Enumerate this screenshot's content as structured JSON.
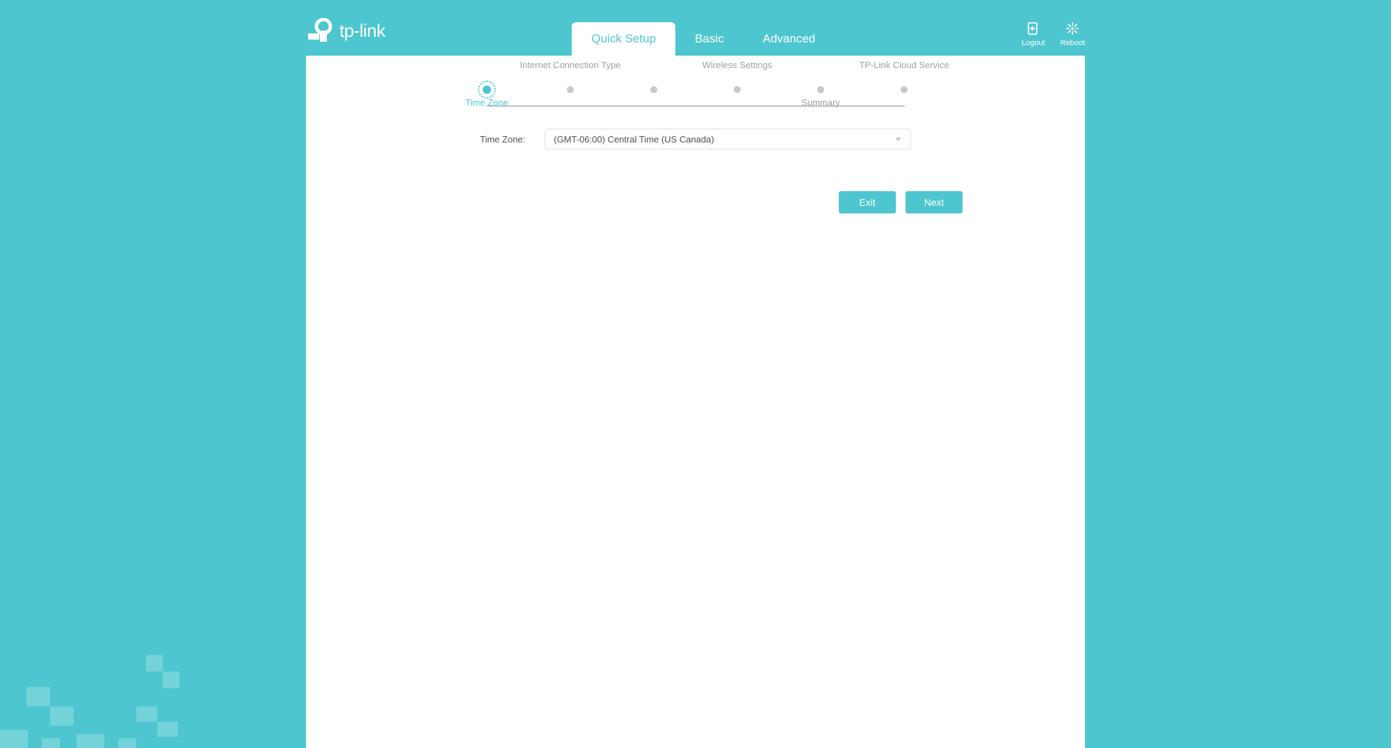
{
  "brand": "tp-link",
  "nav": {
    "tabs": [
      {
        "label": "Quick Setup",
        "active": true
      },
      {
        "label": "Basic",
        "active": false
      },
      {
        "label": "Advanced",
        "active": false
      }
    ],
    "actions": {
      "logout": "Logout",
      "reboot": "Reboot"
    }
  },
  "wizard": {
    "steps": [
      {
        "label": "Time Zone",
        "pos": "bottom",
        "active": true
      },
      {
        "label": "Internet Connection Type",
        "pos": "top",
        "active": false
      },
      {
        "label": "",
        "pos": "top",
        "active": false
      },
      {
        "label": "Wireless Settings",
        "pos": "top",
        "active": false
      },
      {
        "label": "Summary",
        "pos": "bottom",
        "active": false
      },
      {
        "label": "TP-Link Cloud Service",
        "pos": "top",
        "active": false
      }
    ]
  },
  "form": {
    "timezone_label": "Time Zone:",
    "timezone_value": "(GMT-06:00) Central Time (US Canada)"
  },
  "buttons": {
    "exit": "Exit",
    "next": "Next"
  },
  "colors": {
    "accent": "#4dc6cf"
  }
}
